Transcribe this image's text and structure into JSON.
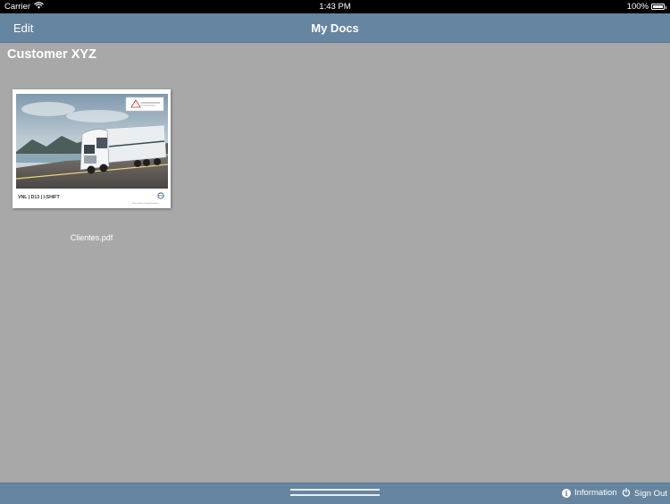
{
  "status_bar": {
    "carrier": "Carrier",
    "time": "1:43 PM",
    "battery": "100%"
  },
  "navbar": {
    "edit_label": "Edit",
    "title": "My Docs"
  },
  "section": {
    "title": "Customer XYZ"
  },
  "documents": [
    {
      "filename": "Clientes.pdf",
      "thumbnail_caption": "VNL | D13 | I-SHIFT",
      "thumbnail_subtext": "Volvo Trucks. Driving Progress"
    }
  ],
  "toolbar": {
    "information_label": "Information",
    "signout_label": "Sign Out"
  },
  "colors": {
    "nav_blue": "#6685a1",
    "background": "#a8a8a8"
  },
  "icons": [
    "wifi-icon",
    "battery-icon",
    "info-icon",
    "power-icon",
    "grip-handle-icon"
  ]
}
